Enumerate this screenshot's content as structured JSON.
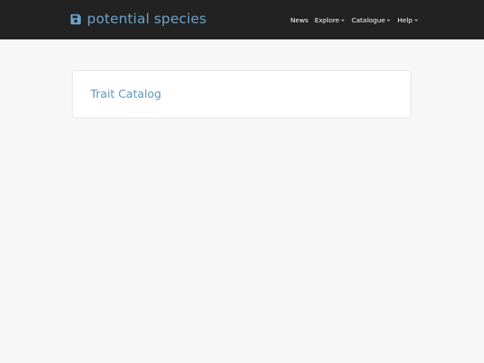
{
  "navbar": {
    "brand": {
      "icon": "floppy-disk-icon",
      "text": "potential species",
      "color": "#6aa3cb"
    },
    "items": [
      {
        "label": "News",
        "has_dropdown": false
      },
      {
        "label": "Explore",
        "has_dropdown": true
      },
      {
        "label": "Catalogue",
        "has_dropdown": true
      },
      {
        "label": "Help",
        "has_dropdown": true
      }
    ],
    "background": "#222222"
  },
  "main": {
    "card": {
      "title": "Trait Catalog",
      "title_color": "#5c95bf"
    }
  }
}
